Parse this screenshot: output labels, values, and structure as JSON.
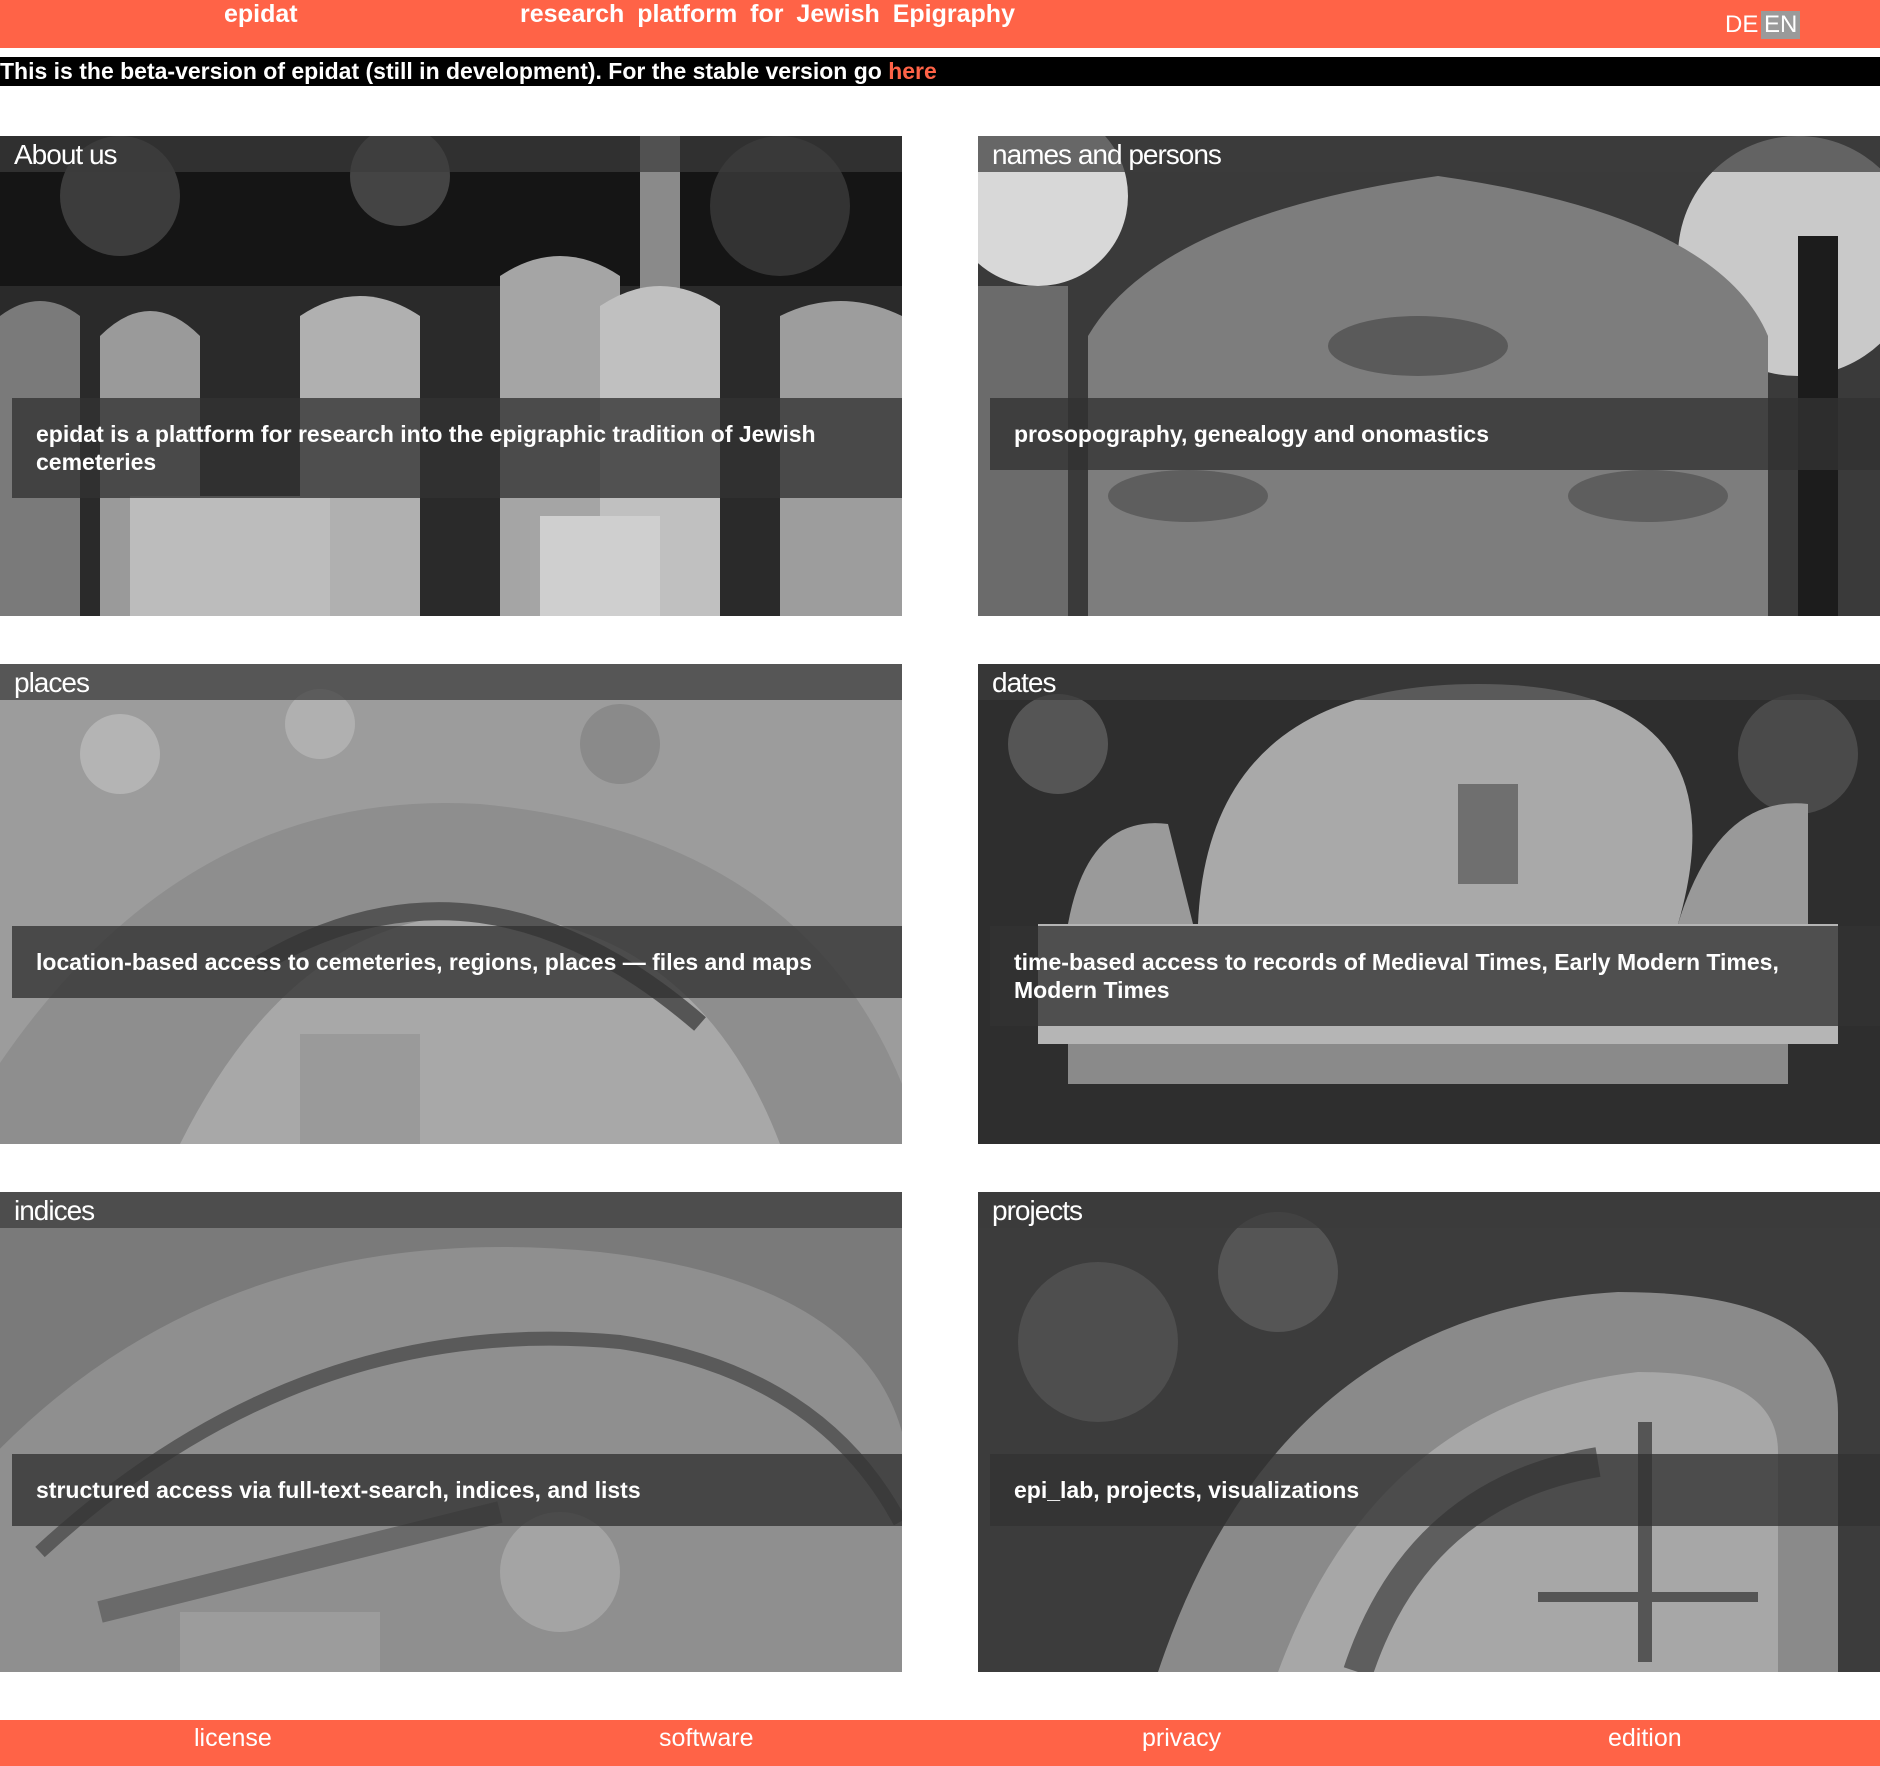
{
  "header": {
    "brand": "epidat",
    "tagline": "research platform for Jewish Epigraphy",
    "languages": [
      "DE",
      "EN"
    ],
    "active_language": "EN"
  },
  "beta_notice": {
    "text": "This is the beta-version of epidat (still in development). For the stable version go ",
    "link_label": "here"
  },
  "tiles": [
    {
      "title": "About us",
      "caption": "epidat is a plattform for research into the epigraphic tradition of Jewish cemeteries"
    },
    {
      "title": "names and persons",
      "caption": "prosopography, genealogy and onomastics"
    },
    {
      "title": "places",
      "caption": "location-based access to cemeteries, regions, places — files and maps"
    },
    {
      "title": "dates",
      "caption": "time-based access to records of Medieval Times, Early Modern Times, Modern Times"
    },
    {
      "title": "indices",
      "caption": "structured access via full-text-search, indices, and lists"
    },
    {
      "title": "projects",
      "caption": "epi_lab, projects, visualizations"
    }
  ],
  "footer": {
    "links": [
      "license",
      "software",
      "privacy",
      "edition"
    ]
  },
  "colors": {
    "accent": "#ff6347",
    "beta_bar": "#000000"
  }
}
